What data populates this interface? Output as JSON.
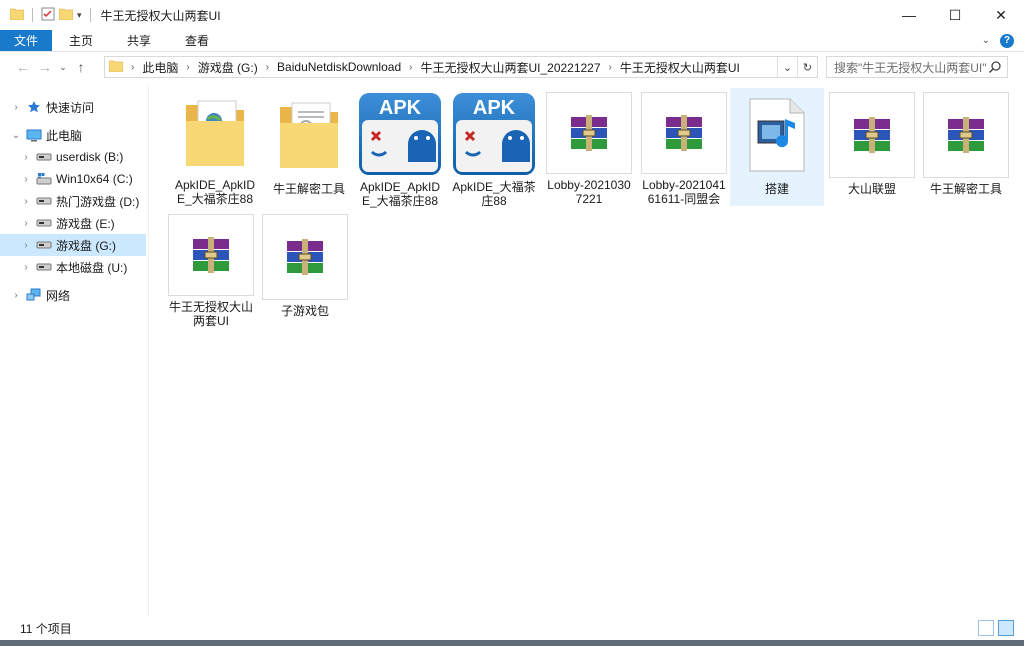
{
  "window": {
    "title": "牛王无授权大山两套UI",
    "controls": [
      "—",
      "☐",
      "✕"
    ]
  },
  "ribbon": {
    "tabs": [
      "文件",
      "主页",
      "共享",
      "查看"
    ]
  },
  "address": {
    "crumbs": [
      "此电脑",
      "游戏盘 (G:)",
      "BaiduNetdiskDownload",
      "牛王无授权大山两套UI_20221227",
      "牛王无授权大山两套UI"
    ],
    "search_placeholder": "搜索\"牛王无授权大山两套UI\""
  },
  "nav": {
    "items": [
      {
        "label": "快速访问",
        "icon": "star-icon"
      },
      {
        "label": "此电脑",
        "icon": "computer-icon"
      },
      {
        "label": "userdisk (B:)",
        "icon": "drive-icon"
      },
      {
        "label": "Win10x64 (C:)",
        "icon": "system-drive-icon"
      },
      {
        "label": "热门游戏盘 (D:)",
        "icon": "drive-icon"
      },
      {
        "label": "游戏盘 (E:)",
        "icon": "drive-icon"
      },
      {
        "label": "游戏盘 (G:)",
        "icon": "drive-icon"
      },
      {
        "label": "本地磁盘 (U:)",
        "icon": "drive-icon"
      },
      {
        "label": "网络",
        "icon": "network-icon"
      }
    ]
  },
  "files": [
    {
      "label": "ApkIDE_ApkIDE_大福茶庄88",
      "icon": "folder-icon"
    },
    {
      "label": "牛王解密工具",
      "icon": "folder-icon"
    },
    {
      "label": "ApkIDE_ApkIDE_大福茶庄88",
      "icon": "apk-icon",
      "badge": "APK"
    },
    {
      "label": "ApkIDE_大福茶庄88",
      "icon": "apk-icon",
      "badge": "APK"
    },
    {
      "label": "Lobby-20210307221",
      "icon": "rar-archive-icon"
    },
    {
      "label": "Lobby-2021041 61611-同盟会",
      "icon": "rar-archive-icon"
    },
    {
      "label": "搭建",
      "icon": "media-file-icon"
    },
    {
      "label": "大山联盟",
      "icon": "rar-archive-icon"
    },
    {
      "label": "牛王解密工具",
      "icon": "rar-archive-icon"
    },
    {
      "label": "牛王无授权大山两套UI",
      "icon": "rar-archive-icon"
    },
    {
      "label": "子游戏包",
      "icon": "rar-archive-icon"
    }
  ],
  "status": {
    "count": "11 个项目"
  },
  "colors": {
    "accent": "#1979ca",
    "selection": "#cce8ff",
    "folder": "#f8d775"
  }
}
